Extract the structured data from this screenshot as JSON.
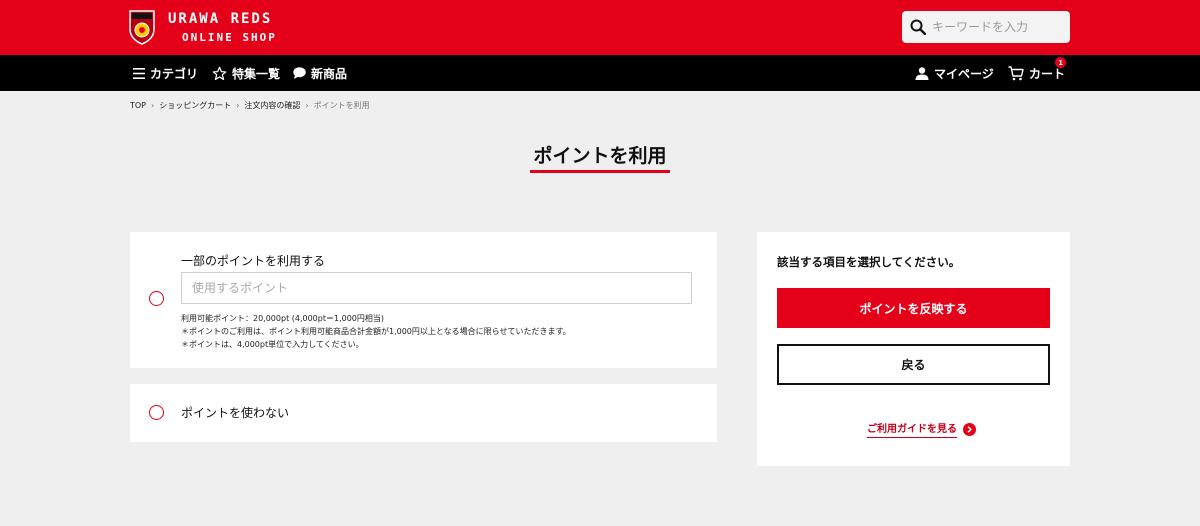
{
  "brand": {
    "line1": "URAWA REDS",
    "line2": "ONLINE SHOP"
  },
  "search": {
    "placeholder": "キーワードを入力"
  },
  "nav": {
    "category": "カテゴリ",
    "features": "特集一覧",
    "new_items": "新商品",
    "mypage": "マイページ",
    "cart": "カート",
    "cart_count": "1"
  },
  "breadcrumb": {
    "top": "TOP",
    "cart": "ショッピングカート",
    "confirm": "注文内容の確認",
    "current": "ポイントを利用"
  },
  "page": {
    "title": "ポイントを利用"
  },
  "options": {
    "partial": {
      "label": "一部のポイントを利用する",
      "placeholder": "使用するポイント",
      "note1": "利用可能ポイント：20,000pt (4,000pt＝1,000円相当)",
      "note2": "＊ポイントのご利用は、ポイント利用可能商品合計金額が1,000円以上となる場合に限らせていただきます。",
      "note3": "＊ポイントは、4,000pt単位で入力してください。"
    },
    "none": {
      "label": "ポイントを使わない"
    }
  },
  "side": {
    "heading": "該当する項目を選択してください。",
    "apply_button": "ポイントを反映する",
    "back_button": "戻る",
    "guide_link": "ご利用ガイドを見る"
  },
  "colors": {
    "brand_red": "#e50019",
    "nav_black": "#000000",
    "background": "#efefef"
  }
}
